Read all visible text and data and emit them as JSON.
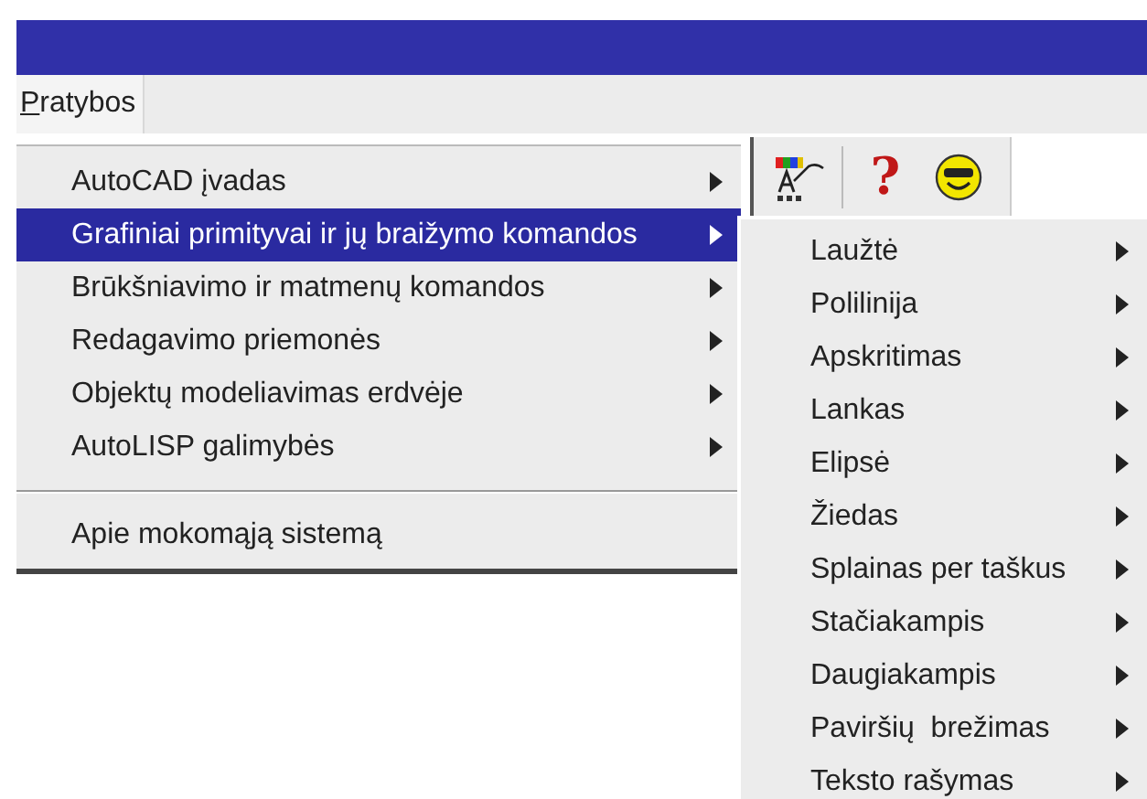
{
  "menu_bar": {
    "items": [
      {
        "label": "Pratybos",
        "open": true,
        "underline_first": true
      }
    ]
  },
  "main_menu": {
    "groups": [
      [
        {
          "label": "AutoCAD įvadas",
          "has_submenu": true,
          "selected": false
        },
        {
          "label": "Grafiniai primityvai ir jų braižymo komandos",
          "has_submenu": true,
          "selected": true
        },
        {
          "label": "Brūkšniavimo ir matmenų komandos",
          "has_submenu": true,
          "selected": false
        },
        {
          "label": "Redagavimo priemonės",
          "has_submenu": true,
          "selected": false
        },
        {
          "label": "Objektų modeliavimas erdvėje",
          "has_submenu": true,
          "selected": false
        },
        {
          "label": "AutoLISP galimybės",
          "has_submenu": true,
          "selected": false
        }
      ],
      [
        {
          "label": "Apie mokomąją sistemą",
          "has_submenu": false,
          "selected": false
        }
      ]
    ]
  },
  "toolbar": {
    "buttons": [
      {
        "kind": "palette"
      },
      {
        "kind": "help",
        "label": "?"
      },
      {
        "kind": "smiley"
      }
    ]
  },
  "submenu": {
    "items": [
      {
        "label": "Laužtė",
        "has_submenu": true,
        "selected": false
      },
      {
        "label": "Polilinija",
        "has_submenu": true,
        "selected": false
      },
      {
        "label": "Apskritimas",
        "has_submenu": true,
        "selected": false
      },
      {
        "label": "Lankas",
        "has_submenu": true,
        "selected": false
      },
      {
        "label": "Elipsė",
        "has_submenu": true,
        "selected": false
      },
      {
        "label": "Žiedas",
        "has_submenu": true,
        "selected": false
      },
      {
        "label": "Splainas per taškus",
        "has_submenu": true,
        "selected": false
      },
      {
        "label": "Stačiakampis",
        "has_submenu": true,
        "selected": false
      },
      {
        "label": "Daugiakampis",
        "has_submenu": true,
        "selected": false
      },
      {
        "label": "Paviršių  brežimas",
        "has_submenu": true,
        "selected": false
      },
      {
        "label": "Teksto rašymas",
        "has_submenu": true,
        "selected": false
      }
    ]
  }
}
